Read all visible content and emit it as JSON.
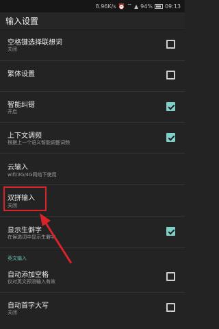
{
  "status_bar": {
    "speed": "8.96K/s",
    "battery": "94%",
    "time": "09:13"
  },
  "title": "输入设置",
  "items": [
    {
      "title": "空格键选择联想词",
      "subtitle": "关闭",
      "checked": false
    },
    {
      "title": "繁体设置",
      "subtitle": "",
      "checked": false
    },
    {
      "title": "智能纠错",
      "subtitle": "开启",
      "checked": true
    },
    {
      "title": "上下文调频",
      "subtitle": "根据上一个语义智能调整词频",
      "checked": true
    },
    {
      "title": "云输入",
      "subtitle": "wifi/3G/4G网络下使用",
      "checked": null
    },
    {
      "title": "双拼输入",
      "subtitle": "关闭",
      "checked": null
    },
    {
      "title": "显示生僻字",
      "subtitle": "在候选词中显示生僻字",
      "checked": true
    },
    {
      "title": "自动添加空格",
      "subtitle": "仅对英文预测输入有效",
      "checked": false
    },
    {
      "title": "自动首字大写",
      "subtitle": "关闭",
      "checked": false
    }
  ],
  "section_english": "英文输入",
  "colors": {
    "accent": "#7fd0c8",
    "annotation": "#d8232a",
    "section": "#69c1b5"
  }
}
